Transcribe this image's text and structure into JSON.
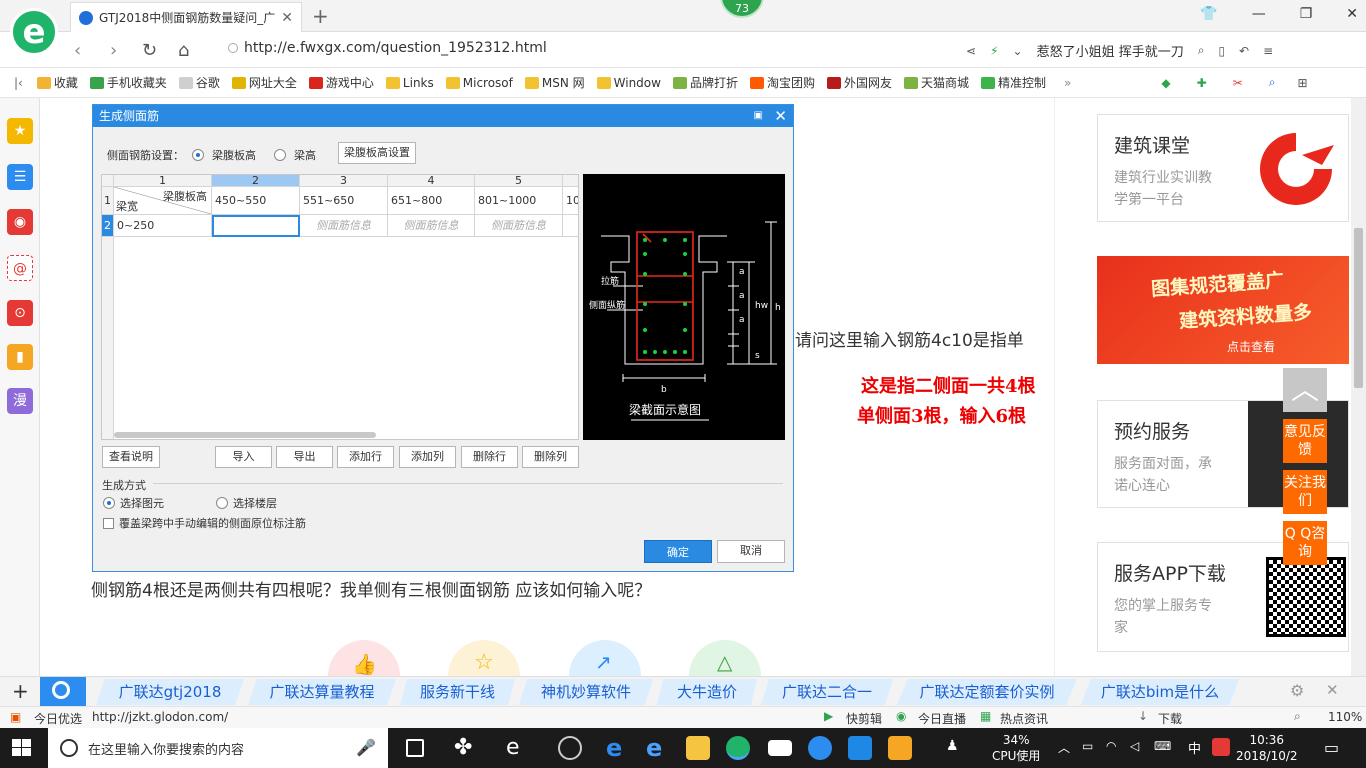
{
  "browser": {
    "tab_title": "GTJ2018中侧面钢筋数量疑问_广",
    "badge": "73",
    "url": "http://e.fwxgx.com/question_1952312.html",
    "news_ticker": "惹怒了小姐姐 挥手就一刀"
  },
  "bookmarks": [
    {
      "label": "收藏",
      "color": "#f2b233"
    },
    {
      "label": "手机收藏夹",
      "color": "#38a34a"
    },
    {
      "label": "谷歌",
      "color": "#cfcfcf"
    },
    {
      "label": "网址大全",
      "color": "#e0b400"
    },
    {
      "label": "游戏中心",
      "color": "#d9261c"
    },
    {
      "label": "Links",
      "color": "#f2c230"
    },
    {
      "label": "Microsof",
      "color": "#f2c230"
    },
    {
      "label": "MSN 网",
      "color": "#f2c230"
    },
    {
      "label": "Window",
      "color": "#f2c230"
    },
    {
      "label": "品牌打折",
      "color": "#7cb342"
    },
    {
      "label": "淘宝团购",
      "color": "#ff5a00"
    },
    {
      "label": "外国网友",
      "color": "#b71c1c"
    },
    {
      "label": "天猫商城",
      "color": "#7cb342"
    },
    {
      "label": "精准控制",
      "color": "#3cb44a"
    }
  ],
  "page": {
    "question_part1": "请问这里输入钢筋4c10是指单",
    "question_part2": "侧钢筋4根还是两侧共有四根呢？我单侧有三根侧面钢筋  应该如何输入呢？",
    "answer_line1": "这是指二侧面一共4根",
    "answer_line2": "单侧面3根，输入6根"
  },
  "dialog": {
    "title": "生成侧面筋",
    "setting_label": "侧面钢筋设置：",
    "radio1": "梁腹板高",
    "radio2": "梁高",
    "setting_button": "梁腹板高设置",
    "col_headers": [
      "1",
      "2",
      "3",
      "4",
      "5"
    ],
    "row_numbers": [
      "1",
      "2"
    ],
    "corner_top": "梁腹板高",
    "corner_bottom": "梁宽",
    "ranges": [
      "450~550",
      "551~650",
      "651~800",
      "801~1000",
      "10"
    ],
    "row2_first": "0~250",
    "placeholder": "侧面筋信息",
    "diagram_labels": {
      "tie": "拉筋",
      "side": "侧面纵筋",
      "caption": "梁截面示意图",
      "a": "a",
      "hw": "hw",
      "h": "h",
      "s": "s",
      "b": "b"
    },
    "buttons": [
      "查看说明",
      "导入",
      "导出",
      "添加行",
      "添加列",
      "删除行",
      "删除列"
    ],
    "gen_label": "生成方式",
    "gen_opt1": "选择图元",
    "gen_opt2": "选择楼层",
    "overwrite": "覆盖梁跨中手动编辑的侧面原位标注筋",
    "ok": "确定",
    "cancel": "取消"
  },
  "sidebar_cards": [
    {
      "title": "建筑课堂",
      "sub1": "建筑行业实训教",
      "sub2": "学第一平台"
    },
    {
      "title": "预约服务",
      "sub1": "服务面对面，承",
      "sub2": "诺心连心"
    },
    {
      "title": "服务APP下载",
      "sub1": "您的掌上服务专",
      "sub2": "家"
    }
  ],
  "banner": {
    "line1": "图集规范覆盖广",
    "line2": "建筑资料数量多",
    "cta": "点击查看"
  },
  "float_buttons": [
    "意见反馈",
    "关注我们",
    "Q Q咨询"
  ],
  "hot_links": [
    "广联达gtj2018",
    "广联达算量教程",
    "服务新干线",
    "神机妙算软件",
    "大牛造价",
    "广联达二合一",
    "广联达定额套价实例",
    "广联达bim是什么"
  ],
  "status": {
    "left": "今日优选",
    "url": "http://jzkt.glodon.com/",
    "items": [
      "快剪辑",
      "今日直播",
      "热点资讯",
      "下载"
    ],
    "zoom": "110%"
  },
  "taskbar": {
    "search": "在这里输入你要搜索的内容",
    "cpu": "34%",
    "cpu_label": "CPU使用",
    "lang": "中",
    "time": "10:36",
    "date": "2018/10/2"
  }
}
